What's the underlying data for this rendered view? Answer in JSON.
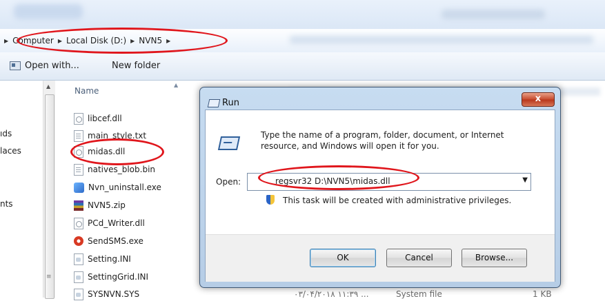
{
  "breadcrumb": {
    "items": [
      "Computer",
      "Local Disk (D:)",
      "NVN5"
    ]
  },
  "toolbar": {
    "open_with": "Open with...",
    "new_folder": "New folder"
  },
  "navpane": {
    "items": [
      "ıds",
      "laces",
      "nts"
    ]
  },
  "filelist": {
    "column_name": "Name",
    "files": [
      {
        "name": "libcef.dll",
        "icon": "dll-file-icon"
      },
      {
        "name": "main_style.txt",
        "icon": "text-file-icon"
      },
      {
        "name": "midas.dll",
        "icon": "dll-file-icon"
      },
      {
        "name": "natives_blob.bin",
        "icon": "file-icon"
      },
      {
        "name": "Nvn_uninstall.exe",
        "icon": "exe-icon"
      },
      {
        "name": "NVN5.zip",
        "icon": "zip-icon"
      },
      {
        "name": "PCd_Writer.dll",
        "icon": "dll-file-icon"
      },
      {
        "name": "SendSMS.exe",
        "icon": "sms-app-icon"
      },
      {
        "name": "Setting.INI",
        "icon": "ini-file-icon"
      },
      {
        "name": "SettingGrid.INI",
        "icon": "ini-file-icon"
      },
      {
        "name": "SYSNVN.SYS",
        "icon": "sys-file-icon"
      }
    ],
    "last_row": {
      "date": "۰۳/۰۴/۲۰۱۸ ۱۱:۳۹ ...",
      "type": "System file",
      "size": "1 KB"
    }
  },
  "run_dialog": {
    "title": "Run",
    "close": "x",
    "description": "Type the name of a program, folder, document, or Internet resource, and Windows will open it for you.",
    "open_label": "Open:",
    "open_value": "regsvr32  D:\\NVN5\\midas.dll",
    "privilege_note": "This task will be created with administrative privileges.",
    "ok": "OK",
    "cancel": "Cancel",
    "browse": "Browse..."
  },
  "colors": {
    "annotation": "#e0161c",
    "dialog_frame": "#b6cde6"
  }
}
